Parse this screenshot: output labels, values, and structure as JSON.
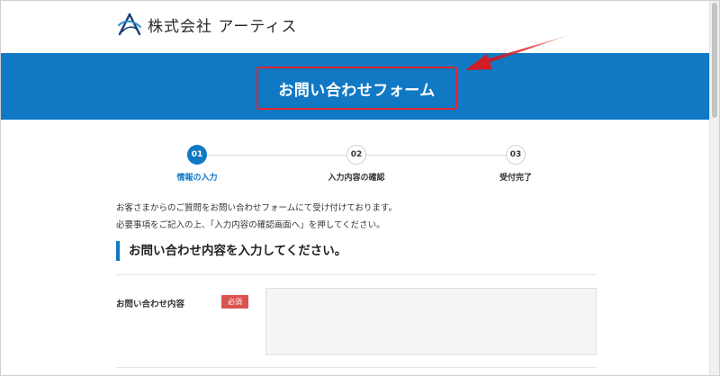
{
  "header": {
    "company_name": "株式会社 アーティス"
  },
  "banner": {
    "title": "お問い合わせフォーム"
  },
  "steps": [
    {
      "number": "01",
      "label": "情報の入力",
      "active": true
    },
    {
      "number": "02",
      "label": "入力内容の確認",
      "active": false
    },
    {
      "number": "03",
      "label": "受付完了",
      "active": false
    }
  ],
  "intro": {
    "line1": "お客さまからのご質問をお問い合わせフォームにて受け付けております。",
    "line2": "必要事項をご記入の上、「入力内容の確認画面へ」を押してください。"
  },
  "section": {
    "heading": "お問い合わせ内容を入力してください。"
  },
  "form": {
    "inquiry_label": "お問い合わせ内容",
    "required_badge": "必須",
    "inquiry_value": ""
  },
  "colors": {
    "brand_blue": "#1178c4",
    "highlight_red": "#e0262c",
    "required_red": "#d9534f"
  }
}
